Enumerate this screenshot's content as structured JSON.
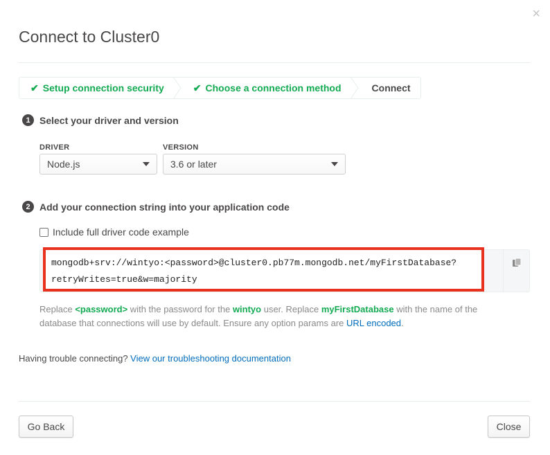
{
  "dialog": {
    "title": "Connect to Cluster0",
    "close_icon": "×"
  },
  "steps": [
    {
      "label": "Setup connection security",
      "done": true
    },
    {
      "label": "Choose a connection method",
      "done": true
    },
    {
      "label": "Connect",
      "done": false
    }
  ],
  "step1": {
    "number": "1",
    "heading": "Select your driver and version",
    "driver_label": "DRIVER",
    "driver_value": "Node.js",
    "version_label": "VERSION",
    "version_value": "3.6 or later"
  },
  "step2": {
    "number": "2",
    "heading": "Add your connection string into your application code",
    "checkbox_label": "Include full driver code example",
    "checkbox_checked": false,
    "connection_string_line1": "mongodb+srv://wintyo:<password>@cluster0.pb77m.mongodb.net/myFirstDatabase?",
    "connection_string_line2": "retryWrites=true&w=majority",
    "copy_icon": "copy-icon"
  },
  "help": {
    "t1": "Replace ",
    "password_token": "<password>",
    "t2": " with the password for the ",
    "user": "wintyo",
    "t3": " user. Replace ",
    "db": "myFirstDatabase",
    "t4": " with the name of the database that connections will use by default. Ensure any option params are ",
    "link": "URL encoded",
    "t5": "."
  },
  "trouble": {
    "text": "Having trouble connecting? ",
    "link": "View our troubleshooting documentation"
  },
  "footer": {
    "back_label": "Go Back",
    "close_label": "Close"
  },
  "colors": {
    "accent_green": "#13aa52",
    "link_blue": "#006cbc",
    "highlight_red": "#e8311e"
  }
}
